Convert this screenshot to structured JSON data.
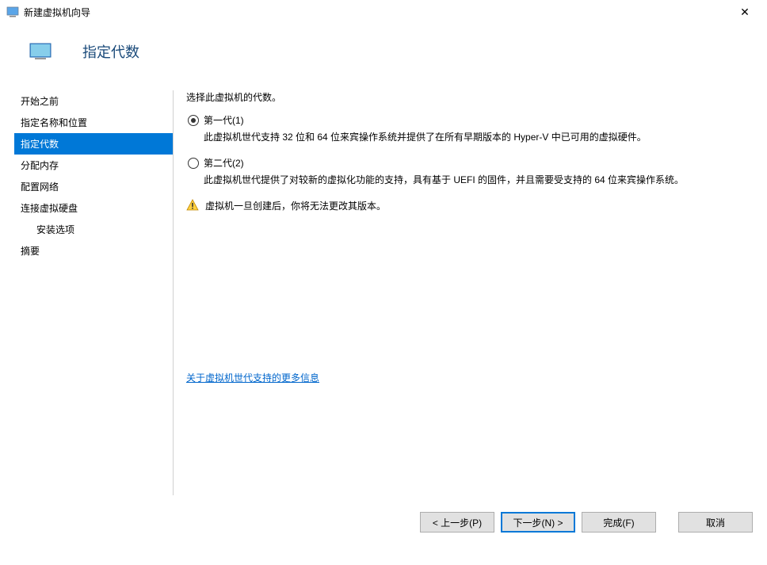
{
  "titlebar": {
    "title": "新建虚拟机向导"
  },
  "header": {
    "title": "指定代数"
  },
  "sidebar": {
    "items": [
      {
        "label": "开始之前"
      },
      {
        "label": "指定名称和位置"
      },
      {
        "label": "指定代数"
      },
      {
        "label": "分配内存"
      },
      {
        "label": "配置网络"
      },
      {
        "label": "连接虚拟硬盘"
      },
      {
        "label": "安装选项"
      },
      {
        "label": "摘要"
      }
    ]
  },
  "main": {
    "prompt": "选择此虚拟机的代数。",
    "option1": {
      "label": "第一代(1)",
      "desc": "此虚拟机世代支持 32 位和 64 位来宾操作系统并提供了在所有早期版本的 Hyper-V 中已可用的虚拟硬件。"
    },
    "option2": {
      "label": "第二代(2)",
      "desc": "此虚拟机世代提供了对较新的虚拟化功能的支持，具有基于 UEFI 的固件，并且需要受支持的 64 位来宾操作系统。"
    },
    "warning": "虚拟机一旦创建后，你将无法更改其版本。",
    "link": "关于虚拟机世代支持的更多信息"
  },
  "footer": {
    "prev": "< 上一步(P)",
    "next": "下一步(N) >",
    "finish": "完成(F)",
    "cancel": "取消"
  }
}
